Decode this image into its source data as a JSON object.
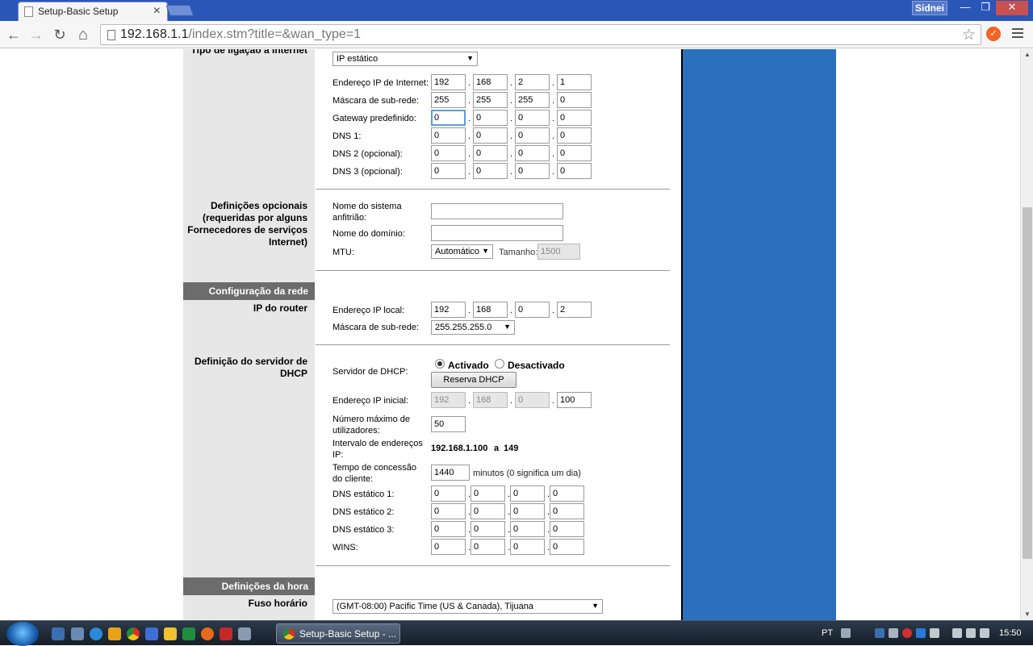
{
  "browser": {
    "tab_title": "Setup-Basic Setup",
    "tab_close": "×",
    "user": "Sidnei",
    "win_min": "—",
    "win_restore": "❐",
    "win_close": "✕",
    "url_host": "192.168.1.1",
    "url_path": "/index.stm?title=&wan_type=1",
    "back": "←",
    "forward": "→",
    "reload": "↻",
    "home": "⌂",
    "star": "☆",
    "ext": "✓"
  },
  "internet": {
    "left_label": "Tipo de ligação à Internet",
    "type_select": "IP estático",
    "rows": [
      {
        "label": "Endereço IP de Internet:",
        "v": [
          "192",
          "168",
          "2",
          "1"
        ]
      },
      {
        "label": "Máscara de sub-rede:",
        "v": [
          "255",
          "255",
          "255",
          "0"
        ]
      },
      {
        "label": "Gateway predefinido:",
        "v": [
          "0",
          "0",
          "0",
          "0"
        ]
      },
      {
        "label": "DNS 1:",
        "v": [
          "0",
          "0",
          "0",
          "0"
        ]
      },
      {
        "label": "DNS 2 (opcional):",
        "v": [
          "0",
          "0",
          "0",
          "0"
        ]
      },
      {
        "label": "DNS 3 (opcional):",
        "v": [
          "0",
          "0",
          "0",
          "0"
        ]
      }
    ]
  },
  "optional": {
    "left_label": "Definições opcionais (requeridas por alguns Fornecedores de serviços Internet)",
    "hostname_label": "Nome do sistema anfitrião:",
    "hostname_value": "",
    "domain_label": "Nome do domínio:",
    "domain_value": "",
    "mtu_label": "MTU:",
    "mtu_select": "Automático",
    "size_label": "Tamanho:",
    "size_value": "1500"
  },
  "network": {
    "section_title": "Configuração da rede",
    "left_label": "IP do router",
    "local_ip_label": "Endereço IP local:",
    "local_ip": [
      "192",
      "168",
      "0",
      "2"
    ],
    "mask_label": "Máscara de sub-rede:",
    "mask_select": "255.255.255.0"
  },
  "dhcp": {
    "left_label": "Definição do servidor de DHCP",
    "server_label": "Servidor de DHCP:",
    "enabled_label": "Activado",
    "disabled_label": "Desactivado",
    "reserve_button": "Reserva DHCP",
    "start_ip_label": "Endereço IP inicial:",
    "start_ip": [
      "192",
      "168",
      "0",
      "100"
    ],
    "max_users_label": "Número máximo de utilizadores:",
    "max_users": "50",
    "range_label": "Intervalo de endereços IP:",
    "range_start": "192.168.1.100",
    "range_a": "a",
    "range_end": "149",
    "lease_label": "Tempo de concessão do cliente:",
    "lease_value": "1440",
    "lease_unit": "minutos (0 significa um dia)",
    "static_rows": [
      {
        "label": "DNS estático 1:",
        "v": [
          "0",
          "0",
          "0",
          "0"
        ]
      },
      {
        "label": "DNS estático 2:",
        "v": [
          "0",
          "0",
          "0",
          "0"
        ]
      },
      {
        "label": "DNS estático 3:",
        "v": [
          "0",
          "0",
          "0",
          "0"
        ]
      },
      {
        "label": "WINS:",
        "v": [
          "0",
          "0",
          "0",
          "0"
        ]
      }
    ]
  },
  "time": {
    "section_title": "Definições da hora",
    "left_label": "Fuso horário",
    "tz_select": "(GMT-08:00) Pacific Time (US & Canada), Tijuana"
  },
  "taskbar": {
    "task_label": "Setup-Basic Setup - ...",
    "lang": "PT",
    "clock": "15:50"
  },
  "colors": {
    "blue_panel": "#2b70bd",
    "section_bar": "#6c6c6c",
    "left_panel": "#e7e7e7"
  }
}
